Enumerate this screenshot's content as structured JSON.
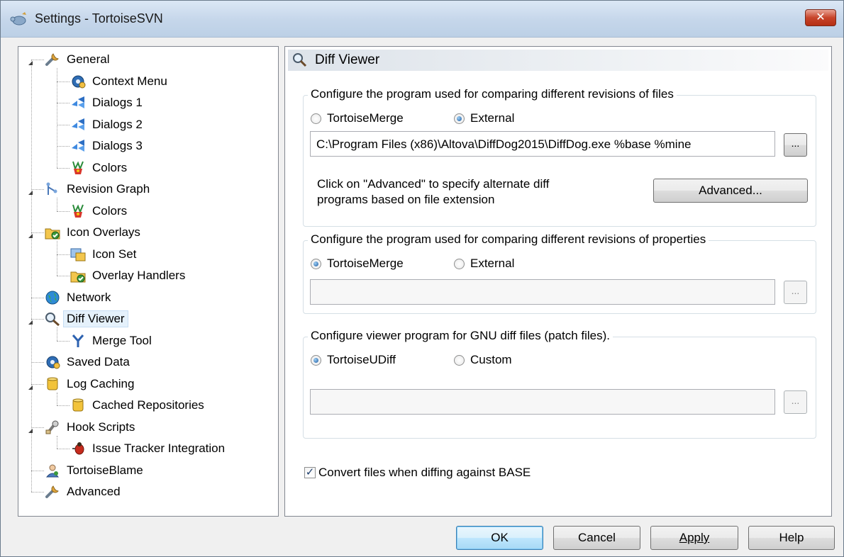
{
  "window": {
    "title": "Settings - TortoiseSVN",
    "close_glyph": "✕"
  },
  "tree": {
    "items": [
      {
        "label": "General",
        "icon": "wrench-icon"
      },
      {
        "label": "Context Menu",
        "icon": "gear-icon"
      },
      {
        "label": "Dialogs 1",
        "icon": "dialogs-icon"
      },
      {
        "label": "Dialogs 2",
        "icon": "dialogs-icon"
      },
      {
        "label": "Dialogs 3",
        "icon": "dialogs-icon"
      },
      {
        "label": "Colors",
        "icon": "palette-icon"
      },
      {
        "label": "Revision Graph",
        "icon": "graph-icon"
      },
      {
        "label": "Colors",
        "icon": "palette-icon"
      },
      {
        "label": "Icon Overlays",
        "icon": "folder-overlay-icon"
      },
      {
        "label": "Icon Set",
        "icon": "icon-set-icon"
      },
      {
        "label": "Overlay Handlers",
        "icon": "folder-overlay-icon"
      },
      {
        "label": "Network",
        "icon": "globe-icon"
      },
      {
        "label": "Diff Viewer",
        "icon": "magnifier-icon"
      },
      {
        "label": "Merge Tool",
        "icon": "merge-icon"
      },
      {
        "label": "Saved Data",
        "icon": "gear-icon"
      },
      {
        "label": "Log Caching",
        "icon": "database-icon"
      },
      {
        "label": "Cached Repositories",
        "icon": "database-icon"
      },
      {
        "label": "Hook Scripts",
        "icon": "hook-icon"
      },
      {
        "label": "Issue Tracker Integration",
        "icon": "bug-icon"
      },
      {
        "label": "TortoiseBlame",
        "icon": "blame-icon"
      },
      {
        "label": "Advanced",
        "icon": "wrench-icon"
      }
    ],
    "selected": "Diff Viewer"
  },
  "page": {
    "title": "Diff Viewer",
    "group_files": {
      "legend": "Configure the program used for comparing different revisions of files",
      "radio_tortoise": "TortoiseMerge",
      "radio_external": "External",
      "selected": "External",
      "path_value": "C:\\Program Files (x86)\\Altova\\DiffDog2015\\DiffDog.exe %base %mine",
      "browse_label": "...",
      "hint_line1": "Click on \"Advanced\" to specify alternate diff",
      "hint_line2": "programs based on file extension",
      "advanced_label": "Advanced..."
    },
    "group_props": {
      "legend": "Configure the program used for comparing different revisions of properties",
      "radio_tortoise": "TortoiseMerge",
      "radio_external": "External",
      "selected": "TortoiseMerge",
      "path_value": "",
      "browse_label": "..."
    },
    "group_patch": {
      "legend": "Configure viewer program for GNU diff files (patch files).",
      "radio_tortoise": "TortoiseUDiff",
      "radio_custom": "Custom",
      "selected": "TortoiseUDiff",
      "path_value": "",
      "browse_label": "..."
    },
    "convert_checkbox": {
      "label": "Convert files when diffing against BASE",
      "checked": true,
      "check_glyph": "✓"
    }
  },
  "buttons": {
    "ok": "OK",
    "cancel": "Cancel",
    "apply": "Apply",
    "help": "Help"
  }
}
